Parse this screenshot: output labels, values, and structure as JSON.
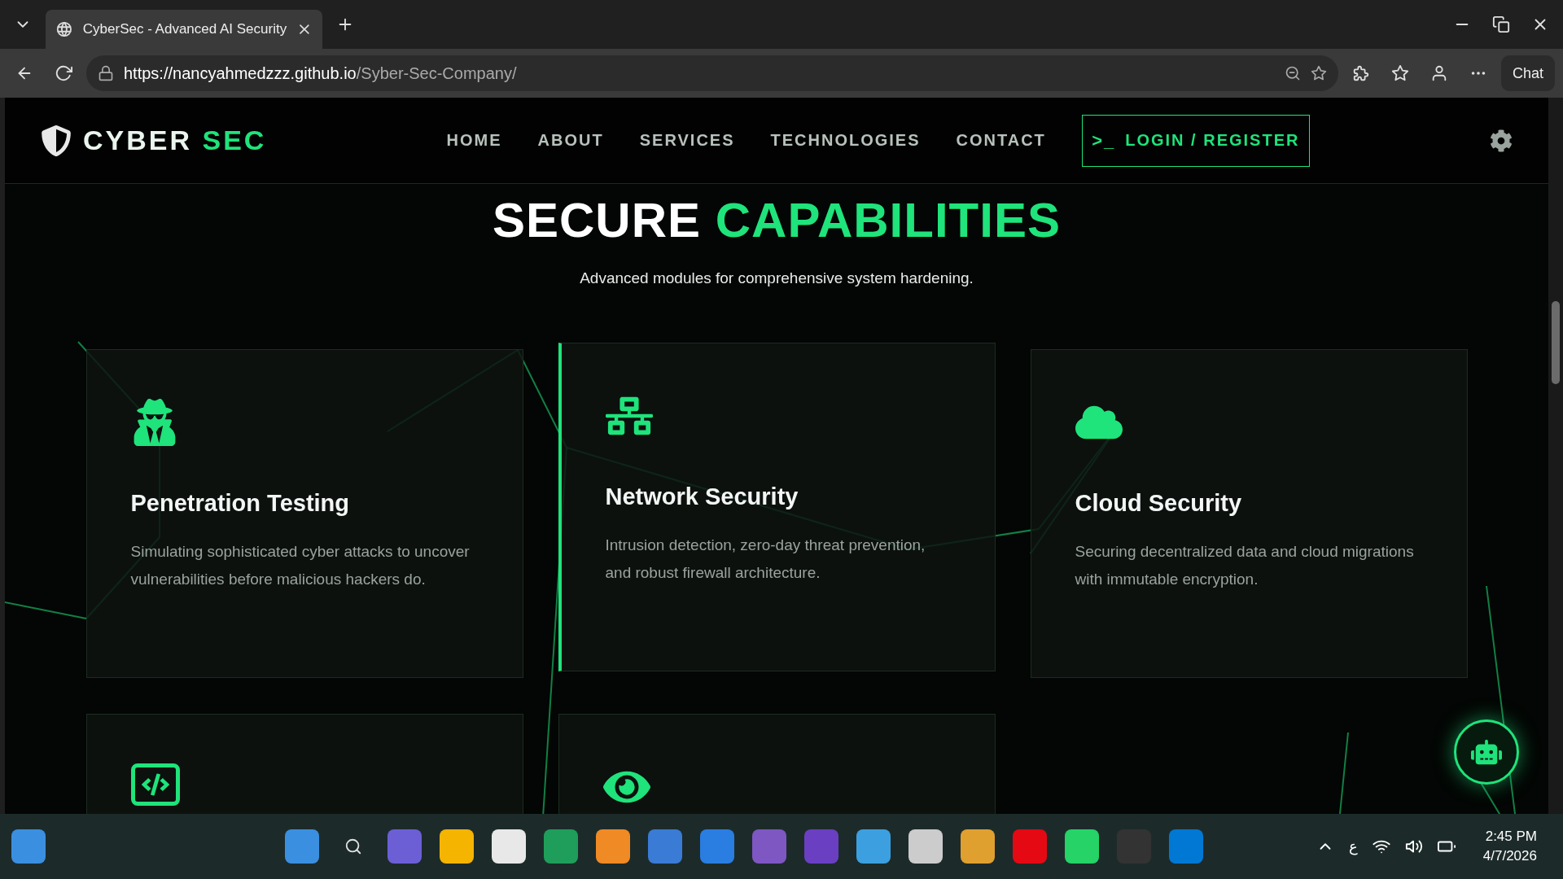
{
  "browser": {
    "tab_title": "CyberSec - Advanced AI Security",
    "url_host": "https://nancyahmedzzz.github.io",
    "url_path": "/Syber-Sec-Company/",
    "chat_label": "Chat"
  },
  "site": {
    "logo_first": "CYBER",
    "logo_second": "SEC",
    "nav": [
      {
        "label": "HOME"
      },
      {
        "label": "ABOUT"
      },
      {
        "label": "SERVICES"
      },
      {
        "label": "TECHNOLOGIES"
      },
      {
        "label": "CONTACT"
      }
    ],
    "login_icon": ">_",
    "login_label": "LOGIN / REGISTER"
  },
  "section": {
    "title_first": "SECURE",
    "title_second": "CAPABILITIES",
    "subtitle": "Advanced modules for comprehensive system hardening."
  },
  "cards": [
    {
      "title": "Penetration Testing",
      "description": "Simulating sophisticated cyber attacks to uncover vulnerabilities before malicious hackers do.",
      "highlighted": false
    },
    {
      "title": "Network Security",
      "description": "Intrusion detection, zero-day threat prevention, and robust firewall architecture.",
      "highlighted": true
    },
    {
      "title": "Cloud Security",
      "description": "Securing decentralized data and cloud migrations with immutable encryption.",
      "highlighted": false
    },
    {
      "highlighted": false
    },
    {
      "highlighted": false
    }
  ],
  "taskbar": {
    "language": "ع",
    "time": "2:45 PM",
    "date": "4/7/2026"
  }
}
